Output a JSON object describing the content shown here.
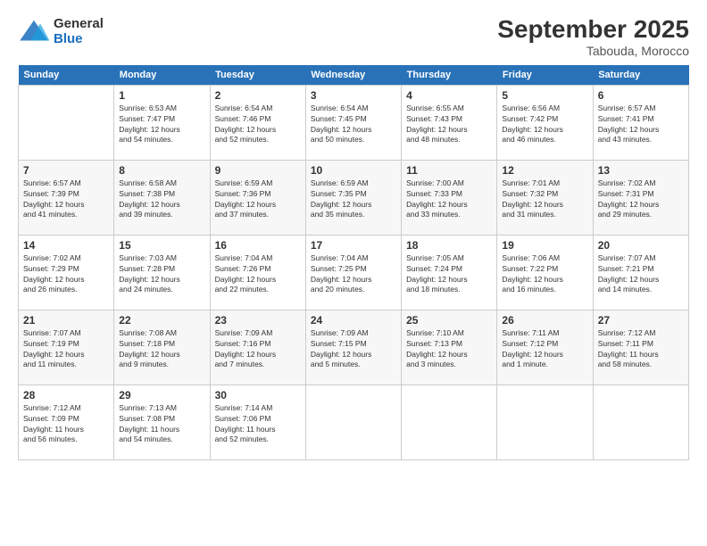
{
  "header": {
    "logo_line1": "General",
    "logo_line2": "Blue",
    "month_title": "September 2025",
    "location": "Tabouda, Morocco"
  },
  "days_of_week": [
    "Sunday",
    "Monday",
    "Tuesday",
    "Wednesday",
    "Thursday",
    "Friday",
    "Saturday"
  ],
  "weeks": [
    [
      {
        "day": "",
        "info": ""
      },
      {
        "day": "1",
        "info": "Sunrise: 6:53 AM\nSunset: 7:47 PM\nDaylight: 12 hours\nand 54 minutes."
      },
      {
        "day": "2",
        "info": "Sunrise: 6:54 AM\nSunset: 7:46 PM\nDaylight: 12 hours\nand 52 minutes."
      },
      {
        "day": "3",
        "info": "Sunrise: 6:54 AM\nSunset: 7:45 PM\nDaylight: 12 hours\nand 50 minutes."
      },
      {
        "day": "4",
        "info": "Sunrise: 6:55 AM\nSunset: 7:43 PM\nDaylight: 12 hours\nand 48 minutes."
      },
      {
        "day": "5",
        "info": "Sunrise: 6:56 AM\nSunset: 7:42 PM\nDaylight: 12 hours\nand 46 minutes."
      },
      {
        "day": "6",
        "info": "Sunrise: 6:57 AM\nSunset: 7:41 PM\nDaylight: 12 hours\nand 43 minutes."
      }
    ],
    [
      {
        "day": "7",
        "info": "Sunrise: 6:57 AM\nSunset: 7:39 PM\nDaylight: 12 hours\nand 41 minutes."
      },
      {
        "day": "8",
        "info": "Sunrise: 6:58 AM\nSunset: 7:38 PM\nDaylight: 12 hours\nand 39 minutes."
      },
      {
        "day": "9",
        "info": "Sunrise: 6:59 AM\nSunset: 7:36 PM\nDaylight: 12 hours\nand 37 minutes."
      },
      {
        "day": "10",
        "info": "Sunrise: 6:59 AM\nSunset: 7:35 PM\nDaylight: 12 hours\nand 35 minutes."
      },
      {
        "day": "11",
        "info": "Sunrise: 7:00 AM\nSunset: 7:33 PM\nDaylight: 12 hours\nand 33 minutes."
      },
      {
        "day": "12",
        "info": "Sunrise: 7:01 AM\nSunset: 7:32 PM\nDaylight: 12 hours\nand 31 minutes."
      },
      {
        "day": "13",
        "info": "Sunrise: 7:02 AM\nSunset: 7:31 PM\nDaylight: 12 hours\nand 29 minutes."
      }
    ],
    [
      {
        "day": "14",
        "info": "Sunrise: 7:02 AM\nSunset: 7:29 PM\nDaylight: 12 hours\nand 26 minutes."
      },
      {
        "day": "15",
        "info": "Sunrise: 7:03 AM\nSunset: 7:28 PM\nDaylight: 12 hours\nand 24 minutes."
      },
      {
        "day": "16",
        "info": "Sunrise: 7:04 AM\nSunset: 7:26 PM\nDaylight: 12 hours\nand 22 minutes."
      },
      {
        "day": "17",
        "info": "Sunrise: 7:04 AM\nSunset: 7:25 PM\nDaylight: 12 hours\nand 20 minutes."
      },
      {
        "day": "18",
        "info": "Sunrise: 7:05 AM\nSunset: 7:24 PM\nDaylight: 12 hours\nand 18 minutes."
      },
      {
        "day": "19",
        "info": "Sunrise: 7:06 AM\nSunset: 7:22 PM\nDaylight: 12 hours\nand 16 minutes."
      },
      {
        "day": "20",
        "info": "Sunrise: 7:07 AM\nSunset: 7:21 PM\nDaylight: 12 hours\nand 14 minutes."
      }
    ],
    [
      {
        "day": "21",
        "info": "Sunrise: 7:07 AM\nSunset: 7:19 PM\nDaylight: 12 hours\nand 11 minutes."
      },
      {
        "day": "22",
        "info": "Sunrise: 7:08 AM\nSunset: 7:18 PM\nDaylight: 12 hours\nand 9 minutes."
      },
      {
        "day": "23",
        "info": "Sunrise: 7:09 AM\nSunset: 7:16 PM\nDaylight: 12 hours\nand 7 minutes."
      },
      {
        "day": "24",
        "info": "Sunrise: 7:09 AM\nSunset: 7:15 PM\nDaylight: 12 hours\nand 5 minutes."
      },
      {
        "day": "25",
        "info": "Sunrise: 7:10 AM\nSunset: 7:13 PM\nDaylight: 12 hours\nand 3 minutes."
      },
      {
        "day": "26",
        "info": "Sunrise: 7:11 AM\nSunset: 7:12 PM\nDaylight: 12 hours\nand 1 minute."
      },
      {
        "day": "27",
        "info": "Sunrise: 7:12 AM\nSunset: 7:11 PM\nDaylight: 11 hours\nand 58 minutes."
      }
    ],
    [
      {
        "day": "28",
        "info": "Sunrise: 7:12 AM\nSunset: 7:09 PM\nDaylight: 11 hours\nand 56 minutes."
      },
      {
        "day": "29",
        "info": "Sunrise: 7:13 AM\nSunset: 7:08 PM\nDaylight: 11 hours\nand 54 minutes."
      },
      {
        "day": "30",
        "info": "Sunrise: 7:14 AM\nSunset: 7:06 PM\nDaylight: 11 hours\nand 52 minutes."
      },
      {
        "day": "",
        "info": ""
      },
      {
        "day": "",
        "info": ""
      },
      {
        "day": "",
        "info": ""
      },
      {
        "day": "",
        "info": ""
      }
    ]
  ]
}
